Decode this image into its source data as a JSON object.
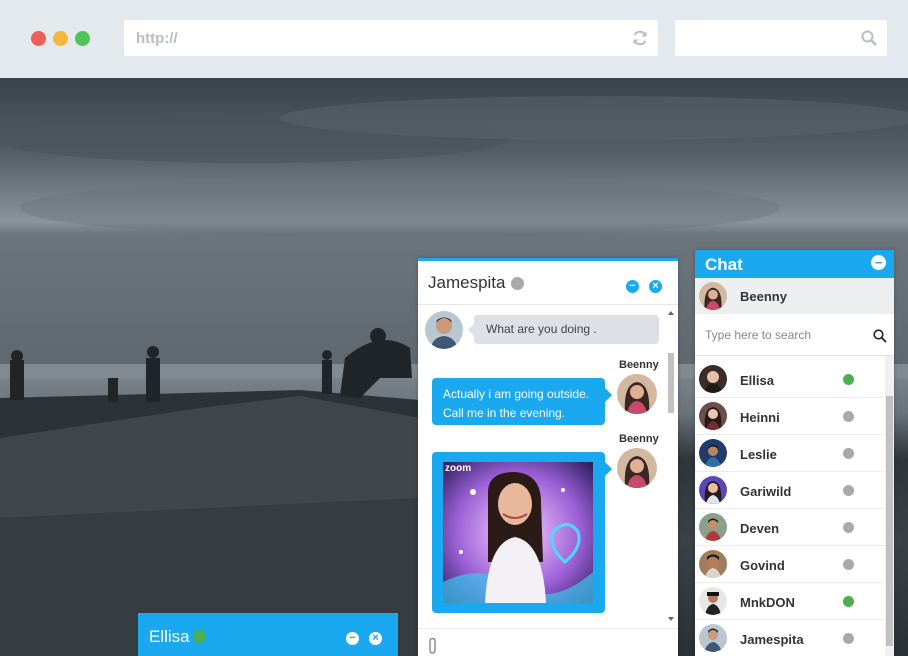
{
  "browser": {
    "url_placeholder": "http://",
    "search_value": ""
  },
  "chat_window": {
    "contact_name": "Jamespita",
    "contact_status_color": "#a9a9a9",
    "messages": [
      {
        "direction": "incoming",
        "text": "What are you doing ."
      },
      {
        "direction": "outgoing",
        "sender": "Beenny",
        "lines": [
          "Actually i am going outside.",
          "Call me in the evening."
        ]
      },
      {
        "direction": "outgoing",
        "sender": "Beenny",
        "type": "image",
        "image_caption": "zoom"
      }
    ]
  },
  "minimized_chat": {
    "contact_name": "Ellisa",
    "contact_status_color": "#4caf50"
  },
  "contact_panel": {
    "title": "Chat",
    "current_user": "Beenny",
    "search_placeholder": "Type here to search",
    "contacts": [
      {
        "name": "Ellisa",
        "online": true
      },
      {
        "name": "Heinni",
        "online": false
      },
      {
        "name": "Leslie",
        "online": false
      },
      {
        "name": "Gariwild",
        "online": false
      },
      {
        "name": "Deven",
        "online": false
      },
      {
        "name": "Govind",
        "online": false
      },
      {
        "name": "MnkDON",
        "online": true
      },
      {
        "name": "Jamespita",
        "online": false
      }
    ]
  },
  "colors": {
    "accent": "#1aa9ee",
    "online": "#4caf50",
    "offline": "#a9a9a9"
  }
}
